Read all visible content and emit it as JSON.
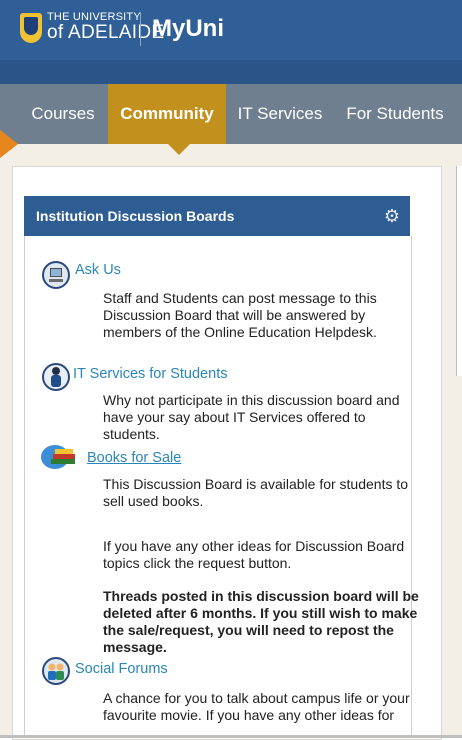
{
  "header": {
    "logo_line1": "THE UNIVERSITY",
    "logo_line2": "of ADELAIDE",
    "brand": "MyUni"
  },
  "nav": {
    "tabs": [
      {
        "label": "Courses",
        "active": false
      },
      {
        "label": "Community",
        "active": true
      },
      {
        "label": "IT Services",
        "active": false
      },
      {
        "label": "For Students",
        "active": false
      }
    ]
  },
  "module": {
    "title": "Institution Discussion Boards",
    "items": [
      {
        "title": "Ask Us",
        "icon": "computer-user-icon",
        "description": "Staff and Students can post message to this Discussion Board that will be answered by members of the Online Education Helpdesk."
      },
      {
        "title": "IT Services for Students",
        "icon": "person-icon",
        "description": "Why not participate in this discussion board and have your say about IT Services offered to students."
      },
      {
        "title": "Books for Sale",
        "icon": "books-icon",
        "description": "This Discussion Board is available for students to sell used books.",
        "extra": "If you have any other ideas for Discussion Board topics click the request button.",
        "notice": "Threads posted in this discussion board will be deleted after 6 months. If you still wish to make the sale/request, you will need to repost the message."
      },
      {
        "title": "Social Forums",
        "icon": "group-icon",
        "description": "A chance for you to talk about campus life or your favourite movie. If you have any other ideas for"
      }
    ]
  },
  "colors": {
    "header_bg": "#2f5f96",
    "nav_bg": "#6f7f8f",
    "active_tab": "#c2901c",
    "link": "#2a86b9",
    "module_header": "#2e5d93"
  }
}
